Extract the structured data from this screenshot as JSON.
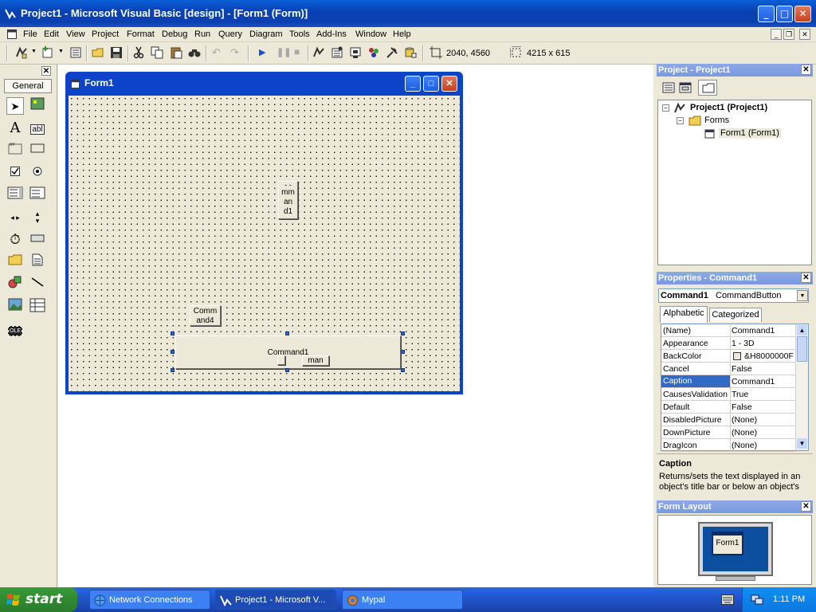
{
  "window": {
    "title": "Project1 - Microsoft Visual Basic [design] - [Form1 (Form)]"
  },
  "menubar": [
    "File",
    "Edit",
    "View",
    "Project",
    "Format",
    "Debug",
    "Run",
    "Query",
    "Diagram",
    "Tools",
    "Add-Ins",
    "Window",
    "Help"
  ],
  "toolbar": {
    "position_readout": "2040, 4560",
    "size_readout": "4215 x 615"
  },
  "toolbox": {
    "tab_label": "General"
  },
  "form_window": {
    "title": "Form1",
    "controls": {
      "command1_caption": "Command1",
      "command4_line1": "Comm",
      "command4_line2": "and4",
      "narrow_line0": "- -",
      "narrow_line1": "mm",
      "narrow_line2": "an",
      "narrow_line3": "d1",
      "overlap_caption": "man"
    }
  },
  "project_explorer": {
    "title": "Project - Project1",
    "root": "Project1 (Project1)",
    "folder": "Forms",
    "item": "Form1 (Form1)"
  },
  "properties": {
    "title": "Properties - Command1",
    "object_name": "Command1",
    "object_type": "CommandButton",
    "tabs": [
      "Alphabetic",
      "Categorized"
    ],
    "rows": [
      {
        "name": "(Name)",
        "value": "Command1"
      },
      {
        "name": "Appearance",
        "value": "1 - 3D"
      },
      {
        "name": "BackColor",
        "value": "&H8000000F"
      },
      {
        "name": "Cancel",
        "value": "False"
      },
      {
        "name": "Caption",
        "value": "Command1"
      },
      {
        "name": "CausesValidation",
        "value": "True"
      },
      {
        "name": "Default",
        "value": "False"
      },
      {
        "name": "DisabledPicture",
        "value": "(None)"
      },
      {
        "name": "DownPicture",
        "value": "(None)"
      },
      {
        "name": "DragIcon",
        "value": "(None)"
      }
    ],
    "desc_title": "Caption",
    "desc_text": "Returns/sets the text displayed in an object's title bar or below an object's"
  },
  "form_layout": {
    "title": "Form Layout",
    "preview_label": "Form1"
  },
  "taskbar": {
    "start": "start",
    "tasks": [
      "Network Connections",
      "Project1 - Microsoft V...",
      "Mypal"
    ],
    "clock": "1:11 PM"
  },
  "colors": {
    "titlebar": "#0a5fd8",
    "selection": "#316ac5",
    "start_green": "#3c9a3c"
  }
}
